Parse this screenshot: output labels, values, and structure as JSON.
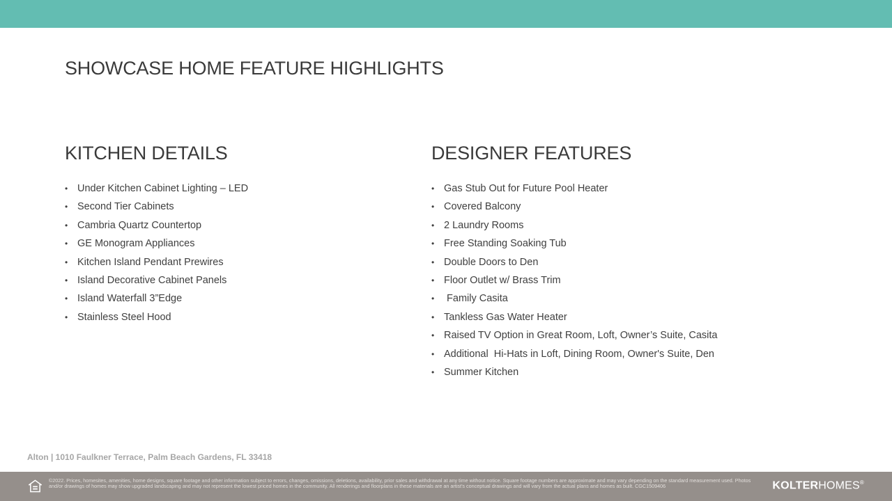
{
  "colors": {
    "top_bar": "#63bdb2",
    "footer": "#958f8b",
    "text": "#3f3f3f",
    "address": "#a6a6a6"
  },
  "title": "SHOWCASE HOME FEATURE HIGHLIGHTS",
  "kitchen": {
    "heading": "KITCHEN DETAILS",
    "items": [
      "Under Kitchen Cabinet Lighting – LED",
      "Second Tier Cabinets",
      "Cambria Quartz Countertop",
      "GE Monogram Appliances",
      "Kitchen Island Pendant Prewires",
      "Island Decorative Cabinet Panels",
      "Island Waterfall 3”Edge",
      "Stainless Steel Hood"
    ]
  },
  "designer": {
    "heading": "DESIGNER FEATURES",
    "items": [
      "Gas Stub Out for Future Pool Heater",
      "Covered Balcony",
      "2 Laundry Rooms",
      "Free Standing Soaking Tub",
      "Double Doors to Den",
      "Floor Outlet w/ Brass Trim",
      " Family Casita",
      "Tankless Gas Water Heater",
      "Raised TV Option in Great Room, Loft, Owner’s Suite, Casita",
      "Additional  Hi-Hats in Loft, Dining Room, Owner's Suite, Den",
      "Summer Kitchen"
    ]
  },
  "bullet": "•",
  "address": "Alton | 1010 Faulkner Terrace, Palm Beach Gardens, FL 33418",
  "footer": {
    "icon": "equal-housing-icon",
    "disclaimer": "©2022. Prices, homesites, amenities, home designs, square footage and other information subject to errors, changes, omissions, deletions, availability, prior sales and withdrawal at any time without notice. Square footage numbers are approximate and may vary depending on the standard measurement used. Photos and/or drawings of homes may show upgraded landscaping and may not represent the lowest priced homes in the community. All renderings and floorplans in these materials are an artist’s conceptual drawings and will vary from the actual plans and homes as built. CGC1509406",
    "brand_bold": "KOLTER",
    "brand_light": "HOMES",
    "brand_mark": "®"
  }
}
